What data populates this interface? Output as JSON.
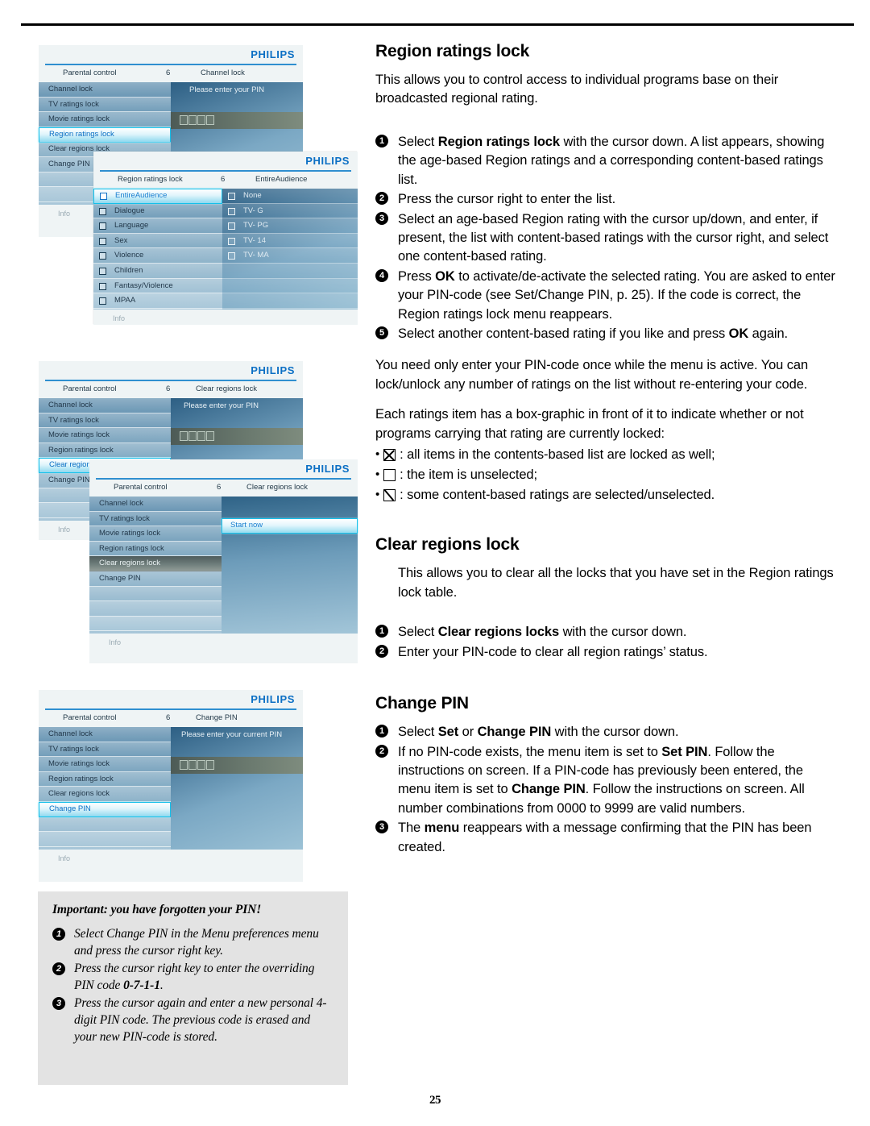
{
  "page": {
    "number": "25"
  },
  "right_column": {
    "section1": {
      "heading": "Region ratings lock",
      "intro": "This allows you to control access to individual programs base on their broadcasted regional rating.",
      "steps": [
        {
          "n": "❶",
          "html": "Select <b>Region ratings lock</b> with the cursor down. A list appears, showing the age-based Region ratings and a corresponding content-based ratings list."
        },
        {
          "n": "❷",
          "html": "Press the cursor right to enter the list."
        },
        {
          "n": "❸",
          "html": "Select an age-based Region rating with the cursor up/down, and enter, if present, the list with content-based ratings with the cursor right, and select one content-based rating."
        },
        {
          "n": "❹",
          "html": "Press <b>OK</b> to activate/de-activate the selected rating. You are asked to enter your PIN-code (see Set/Change PIN, p. 25). If the code is correct, the Region ratings lock menu reappears."
        },
        {
          "n": "❺",
          "html": "Select another content-based rating if you like and press <b>OK</b> again."
        }
      ],
      "note1": "You need only enter your PIN-code once while the menu is active. You can lock/unlock any number of ratings on the list without re-entering your code.",
      "note2": "Each ratings item has a box-graphic in front of it to indicate whether or not programs carrying that rating are currently locked:",
      "bullets": [
        {
          "glyph": "x",
          "text": ": all items in the contents-based list are locked as well;"
        },
        {
          "glyph": "empty",
          "text": ": the item is unselected;"
        },
        {
          "glyph": "slash",
          "text": ": some content-based ratings are selected/unselected."
        }
      ]
    },
    "section2": {
      "heading": "Clear regions lock",
      "intro": "This allows you to clear all the locks that you have set in the Region ratings lock table.",
      "steps": [
        {
          "n": "❶",
          "html": "Select <b>Clear regions locks</b> with the cursor down."
        },
        {
          "n": "❷",
          "html": "Enter your PIN-code to clear all region ratings’ status."
        }
      ]
    },
    "section3": {
      "heading": "Change PIN",
      "steps": [
        {
          "n": "❶",
          "html": "Select <b>Set</b> or <b>Change PIN</b> with the cursor down."
        },
        {
          "n": "❷",
          "html": "If no PIN-code exists, the menu item is set to <b>Set PIN</b>. Follow the instructions on screen. If a PIN-code has previously been entered, the menu item is set to <b>Change PIN</b>. Follow the instructions on screen. All number combinations from 0000 to 9999 are valid numbers."
        },
        {
          "n": "❸",
          "html": "The <b>menu</b> reappears with a message confirming that the PIN has been created."
        }
      ]
    }
  },
  "important_box": {
    "heading": "Important: you have forgotten your PIN!",
    "steps": [
      {
        "n": "❶",
        "html": "Select Change PIN in the Menu preferences menu and press the cursor right key."
      },
      {
        "n": "❷",
        "html": "Press the cursor right key to enter the overriding PIN code <b>0-7-1-1</b>."
      },
      {
        "n": "❸",
        "html": "Press the cursor again and enter a new personal 4-digit PIN code. The previous code is erased and your new PIN-code is stored."
      }
    ]
  },
  "osd_screens": {
    "brand": "PHILIPS",
    "info_label": "Info",
    "screen1a": {
      "crumb": {
        "left": "Parental control",
        "mid": "6",
        "right": "Channel lock"
      },
      "menu": [
        "Channel lock",
        "TV ratings lock",
        "Movie ratings lock",
        "Region ratings lock",
        "Clear regions lock",
        "Change PIN",
        "",
        ""
      ],
      "selected_index": 3,
      "prompt": "Please enter your PIN",
      "pin_digits": 4
    },
    "screen1b": {
      "crumb": {
        "left": "Region ratings lock",
        "mid": "6",
        "right": "EntireAudience"
      },
      "content_list": [
        "EntireAudience",
        "Dialogue",
        "Language",
        "Sex",
        "Violence",
        "Children",
        "Fantasy/Violence",
        "MPAA"
      ],
      "content_selected_index": 0,
      "age_list": [
        "None",
        "TV- G",
        "TV- PG",
        "TV- 14",
        "TV- MA"
      ]
    },
    "screen2a": {
      "crumb": {
        "left": "Parental control",
        "mid": "6",
        "right": "Clear regions lock"
      },
      "menu": [
        "Channel lock",
        "TV ratings lock",
        "Movie ratings lock",
        "Region ratings lock",
        "Clear regions lock",
        "Change PIN",
        "",
        ""
      ],
      "selected_index": 4,
      "prompt": "Please enter your PIN",
      "pin_digits": 4
    },
    "screen2b": {
      "crumb": {
        "left": "Parental control",
        "mid": "6",
        "right": "Clear regions lock"
      },
      "menu": [
        "Channel lock",
        "TV ratings lock",
        "Movie ratings lock",
        "Region ratings lock",
        "Clear regions lock",
        "Change PIN",
        "",
        "",
        ""
      ],
      "selected_index": 4,
      "action_label": "Start now"
    },
    "screen3": {
      "crumb": {
        "left": "Parental control",
        "mid": "6",
        "right": "Change PIN"
      },
      "menu": [
        "Channel lock",
        "TV ratings lock",
        "Movie ratings lock",
        "Region ratings lock",
        "Clear regions lock",
        "Change PIN",
        "",
        ""
      ],
      "selected_index": 5,
      "prompt": "Please enter your current PIN",
      "pin_digits": 4
    }
  },
  "colors": {
    "brand_blue": "#0b6fc4",
    "highlight_cyan": "#15c0ea",
    "panel_bg": "#eff4f5",
    "important_bg": "#e3e3e3"
  }
}
